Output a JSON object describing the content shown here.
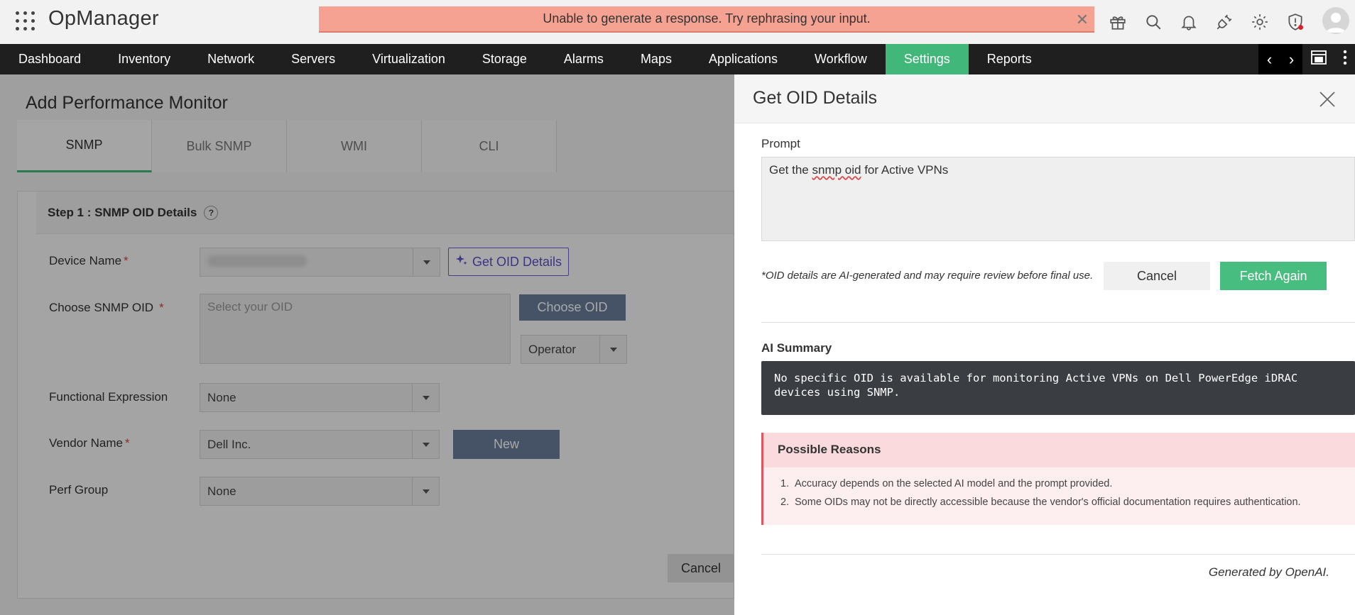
{
  "app": {
    "title": "OpManager"
  },
  "error_banner": {
    "message": "Unable to generate a response. Try rephrasing your input."
  },
  "header_icons": [
    "gift-icon",
    "search-icon",
    "bell-icon",
    "plug-icon",
    "gear-icon",
    "shield-alert-icon"
  ],
  "nav": {
    "items": [
      {
        "label": "Dashboard"
      },
      {
        "label": "Inventory"
      },
      {
        "label": "Network"
      },
      {
        "label": "Servers"
      },
      {
        "label": "Virtualization"
      },
      {
        "label": "Storage"
      },
      {
        "label": "Alarms"
      },
      {
        "label": "Maps"
      },
      {
        "label": "Applications"
      },
      {
        "label": "Workflow"
      },
      {
        "label": "Settings"
      },
      {
        "label": "Reports"
      }
    ],
    "active": "Settings"
  },
  "page": {
    "title": "Add Performance Monitor",
    "tabs": [
      {
        "label": "SNMP"
      },
      {
        "label": "Bulk SNMP"
      },
      {
        "label": "WMI"
      },
      {
        "label": "CLI"
      }
    ],
    "step_title": "Step 1 : SNMP OID Details",
    "help": "?",
    "device_name_label": "Device Name",
    "get_oid_button": "Get OID Details",
    "choose_oid_label": "Choose SNMP OID",
    "oid_placeholder": "Select your OID",
    "choose_oid_button": "Choose OID",
    "operator_value": "Operator",
    "functional_expression_label": "Functional Expression",
    "functional_expression_value": "None",
    "vendor_label": "Vendor Name",
    "vendor_value": "Dell Inc.",
    "new_button": "New",
    "perf_group_label": "Perf Group",
    "perf_group_value": "None",
    "cancel_button": "Cancel",
    "required_mark": "*"
  },
  "panel": {
    "title": "Get OID Details",
    "prompt_label": "Prompt",
    "prompt_before": "Get the ",
    "prompt_misspelled": "snmp oid",
    "prompt_after": " for Active VPNs",
    "disclaimer": "*OID details are AI-generated and may require review before final use.",
    "cancel_button": "Cancel",
    "fetch_button": "Fetch Again",
    "summary_label": "AI Summary",
    "summary_text": "No specific OID is available for monitoring Active VPNs on Dell PowerEdge iDRAC devices using SNMP.",
    "reasons_title": "Possible Reasons",
    "reasons": [
      {
        "num": "1.",
        "text": "Accuracy depends on the selected AI model and the prompt provided."
      },
      {
        "num": "2.",
        "text": "Some OIDs may not be directly accessible because the vendor's official documentation requires authentication."
      }
    ],
    "generated_by": "Generated by OpenAI."
  },
  "colors": {
    "accent": "#41b87a",
    "error_banner": "#f6a293",
    "nav_bg": "#1f1f1f",
    "summary_bg": "#3a3d42"
  }
}
